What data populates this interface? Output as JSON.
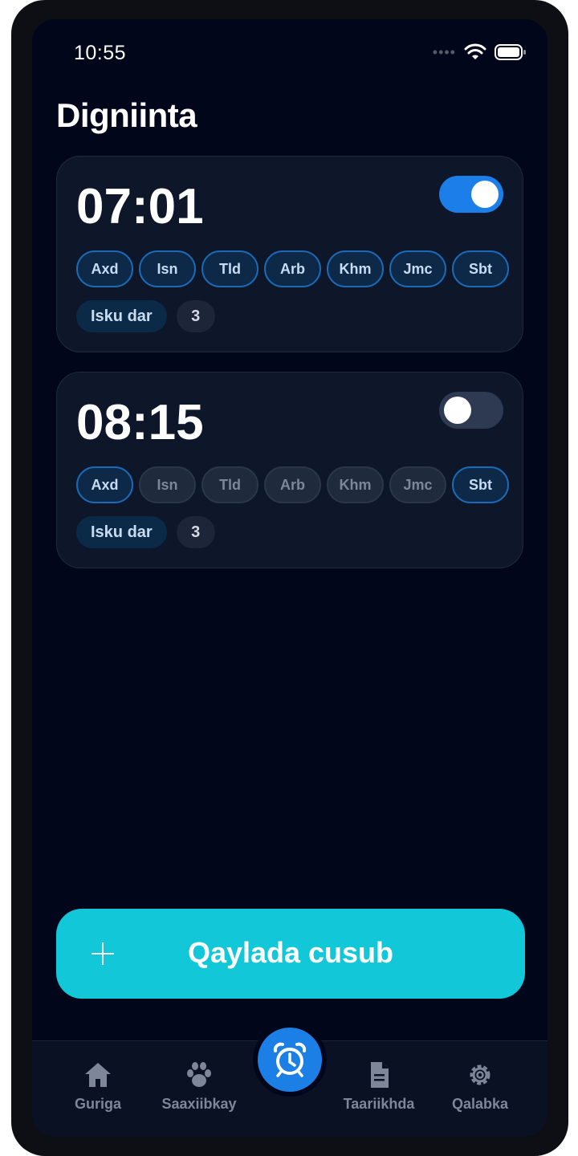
{
  "status_bar": {
    "time": "10:55"
  },
  "page": {
    "title": "Digniinta"
  },
  "alarms": [
    {
      "time": "07:01",
      "enabled": true,
      "days": [
        {
          "label": "Axd",
          "active": true
        },
        {
          "label": "Isn",
          "active": true
        },
        {
          "label": "Tld",
          "active": true
        },
        {
          "label": "Arb",
          "active": true
        },
        {
          "label": "Khm",
          "active": true
        },
        {
          "label": "Jmc",
          "active": true
        },
        {
          "label": "Sbt",
          "active": true
        }
      ],
      "snooze_label": "Isku dar",
      "count": "3"
    },
    {
      "time": "08:15",
      "enabled": false,
      "days": [
        {
          "label": "Axd",
          "active": true
        },
        {
          "label": "Isn",
          "active": false
        },
        {
          "label": "Tld",
          "active": false
        },
        {
          "label": "Arb",
          "active": false
        },
        {
          "label": "Khm",
          "active": false
        },
        {
          "label": "Jmc",
          "active": false
        },
        {
          "label": "Sbt",
          "active": true
        }
      ],
      "snooze_label": "Isku dar",
      "count": "3"
    }
  ],
  "add_button": {
    "label": "Qaylada cusub",
    "icon": "plus-icon"
  },
  "nav": {
    "items": [
      {
        "label": "Guriga",
        "icon": "home-icon"
      },
      {
        "label": "Saaxiibkay",
        "icon": "paw-icon"
      },
      {
        "label": "Taariikhda",
        "icon": "document-icon"
      },
      {
        "label": "Qalabka",
        "icon": "gear-icon"
      }
    ],
    "center_icon": "alarm-clock-icon"
  },
  "colors": {
    "background": "#01061a",
    "card": "#0e1729",
    "accent_blue": "#1c7ee8",
    "accent_cyan": "#12c7d8"
  }
}
